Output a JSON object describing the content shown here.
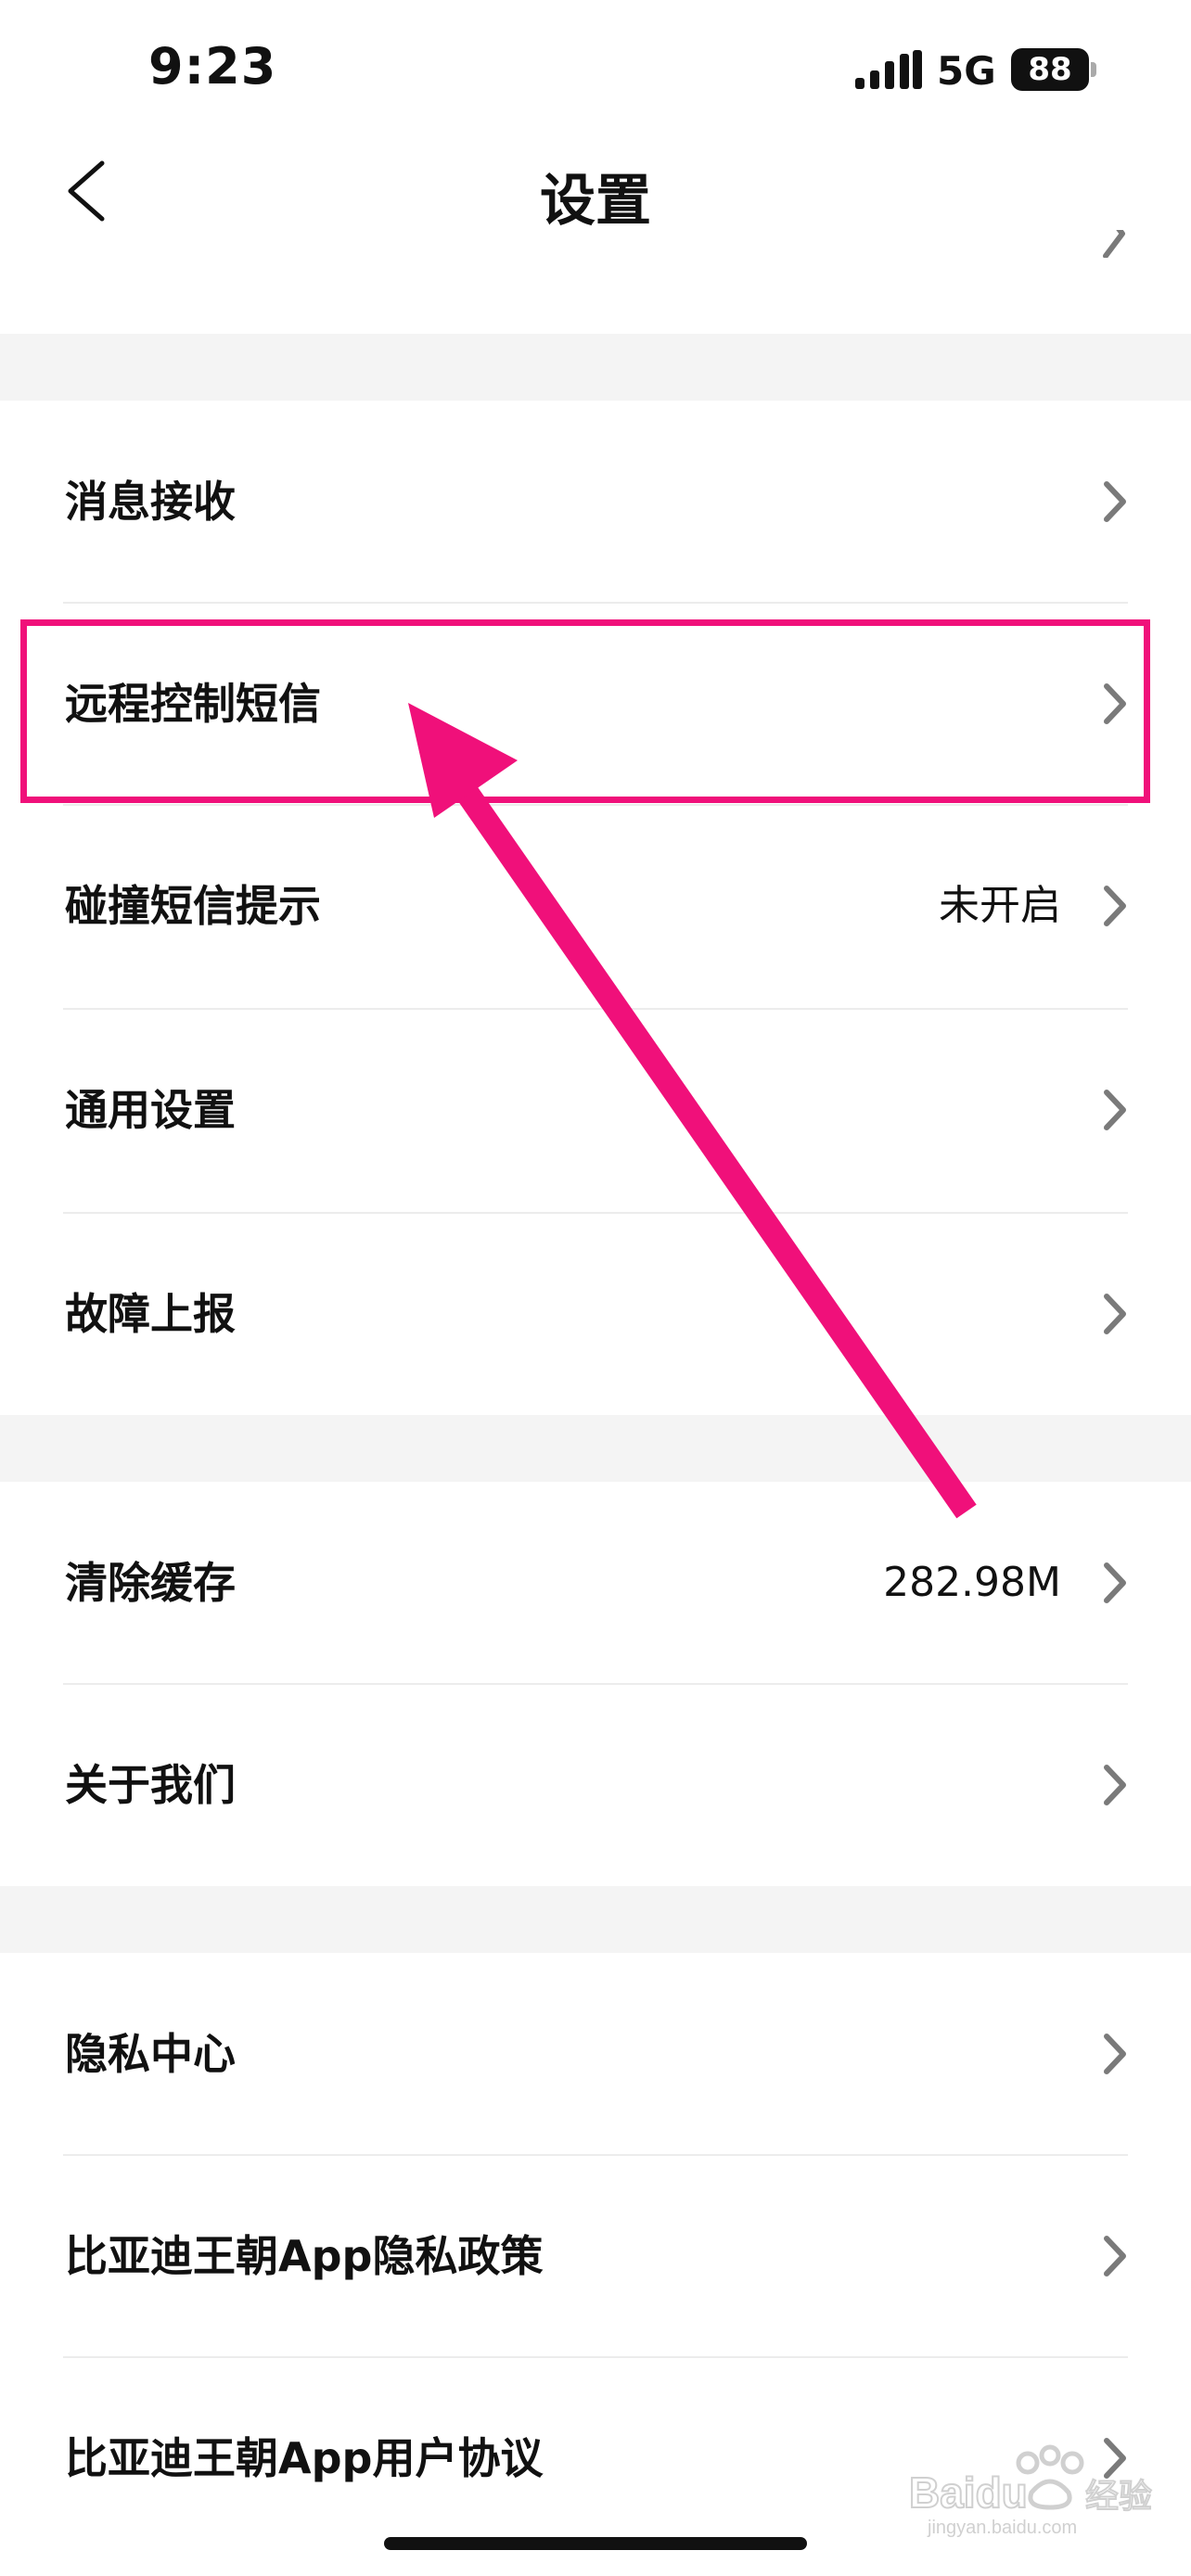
{
  "status_bar": {
    "time": "9:23",
    "network": "5G",
    "battery": "88"
  },
  "header": {
    "title": "设置"
  },
  "sections": [
    {
      "items": [
        {
          "label": "消息接收",
          "value": ""
        },
        {
          "label": "远程控制短信",
          "value": ""
        },
        {
          "label": "碰撞短信提示",
          "value": "未开启"
        },
        {
          "label": "通用设置",
          "value": ""
        },
        {
          "label": "故障上报",
          "value": ""
        }
      ]
    },
    {
      "items": [
        {
          "label": "清除缓存",
          "value": "282.98M"
        },
        {
          "label": "关于我们",
          "value": ""
        }
      ]
    },
    {
      "items": [
        {
          "label": "隐私中心",
          "value": ""
        },
        {
          "label": "比亚迪王朝App隐私政策",
          "value": ""
        },
        {
          "label": "比亚迪王朝App用户协议",
          "value": ""
        }
      ]
    }
  ],
  "annotation": {
    "highlight_color": "#f0107a",
    "highlighted_item": "远程控制短信"
  },
  "watermark": {
    "brand": "Baidu",
    "label": "经验",
    "url": "jingyan.baidu.com"
  },
  "colors": {
    "background": "#ffffff",
    "section_gap": "#f4f4f4",
    "chevron": "#7a7a7a",
    "text": "#111111"
  }
}
